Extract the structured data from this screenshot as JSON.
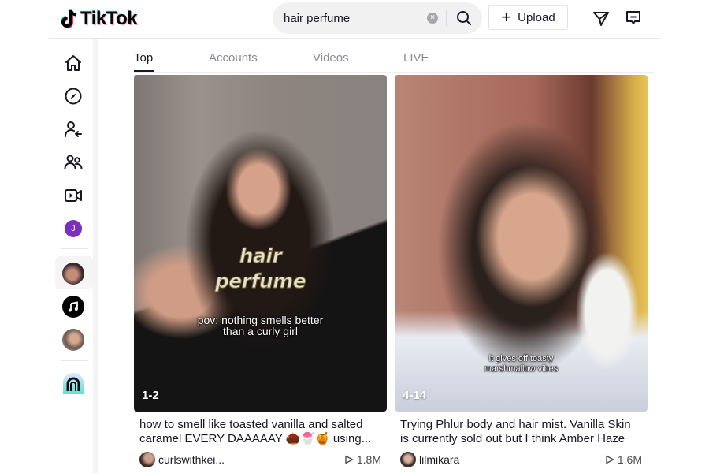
{
  "app": {
    "name": "TikTok"
  },
  "search": {
    "value": "hair perfume",
    "placeholder": "Search"
  },
  "header": {
    "upload_label": "Upload"
  },
  "sidebar": {
    "items": [
      {
        "name": "For You",
        "icon": "home-icon"
      },
      {
        "name": "Explore",
        "icon": "compass-icon"
      },
      {
        "name": "Following",
        "icon": "user-follow-icon"
      },
      {
        "name": "Friends",
        "icon": "friends-icon"
      },
      {
        "name": "LIVE",
        "icon": "live-video-icon"
      },
      {
        "name": "Profile",
        "icon": "profile-avatar",
        "initial": "J",
        "color": "#7b2fbf"
      }
    ],
    "following_avatars": [
      "following-account-1",
      "following-account-2-music",
      "following-account-3"
    ],
    "bottom_icon": "effect-house-icon"
  },
  "tabs": [
    {
      "label": "Top",
      "active": true
    },
    {
      "label": "Accounts",
      "active": false
    },
    {
      "label": "Videos",
      "active": false
    },
    {
      "label": "LIVE",
      "active": false
    }
  ],
  "videos": [
    {
      "overlay_title_line1": "hair",
      "overlay_title_line2": "perfume",
      "overlay_subtitle_line1": "pov: nothing smells better",
      "overlay_subtitle_line2": "than a curly girl",
      "date": "1-2",
      "caption": "how to smell like toasted vanilla and salted caramel EVERY DAAAAAY 🌰🍧🍯 using...",
      "username": "curlswithkei...",
      "views": "1.8M"
    },
    {
      "overlay_subtitle_line1": "it gives off toasty",
      "overlay_subtitle_line2": "marshmallow vibes",
      "date": "4-14",
      "caption": "Trying Phlur body and hair mist. Vanilla Skin is currently sold out but I think Amber Haze is...",
      "username": "lilmikara",
      "views": "1.6M"
    }
  ],
  "colors": {
    "accent": "#fe2c55",
    "accent2": "#25f4ee",
    "text": "#161823",
    "muted": "#8a8b91"
  }
}
